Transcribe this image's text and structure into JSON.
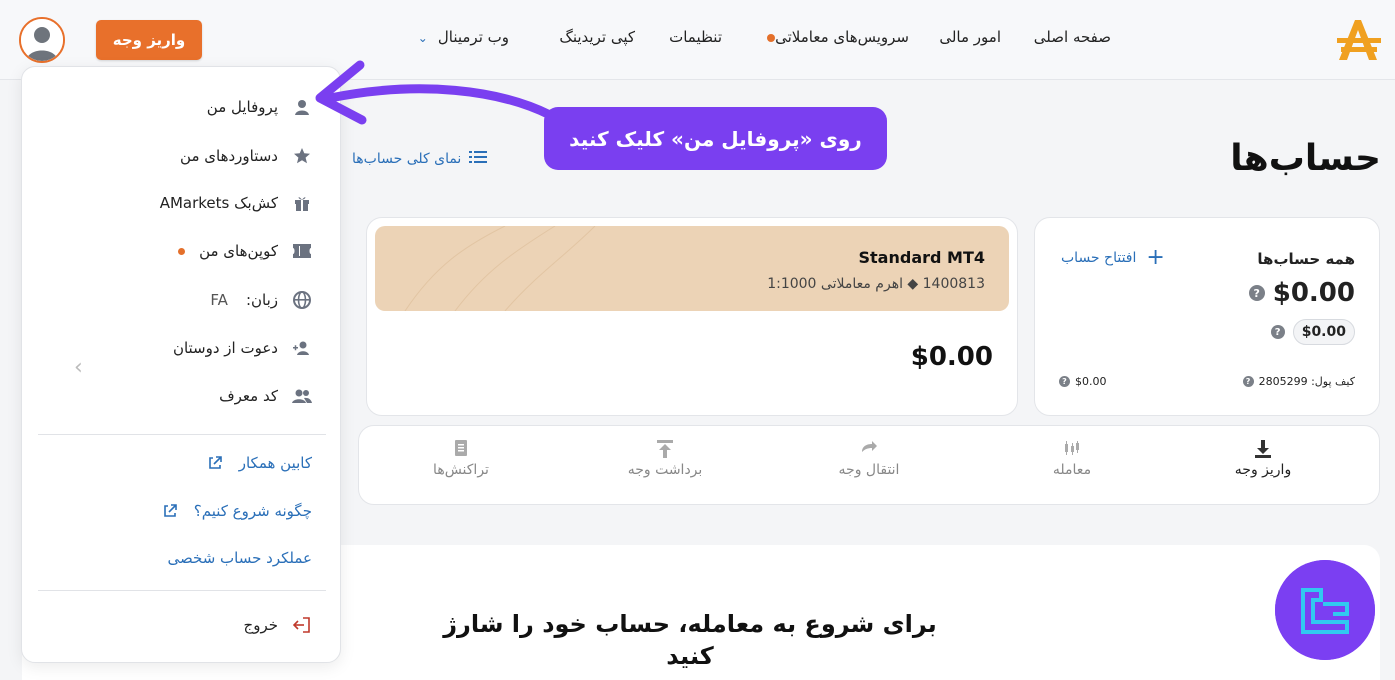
{
  "nav": {
    "home": "صفحه اصلی",
    "finance": "امور مالی",
    "trading_services": "سرویس‌های معاملاتی",
    "settings": "تنظیمات",
    "copy_trading": "کپی تریدینگ",
    "web_terminal": "وب ترمینال",
    "deposit_button": "واریز وجه"
  },
  "page": {
    "title": "حساب‌ها",
    "overview_link": "نمای کلی حساب‌ها"
  },
  "summary": {
    "title": "همه حساب‌ها",
    "open_account": "افتتاح حساب",
    "total": "$0.00",
    "pill": "$0.00",
    "wallet_label": "کیف پول: 2805299",
    "wallet_value": "$0.00"
  },
  "mt4": {
    "name": "Standard MT4",
    "sub": "1400813 ◆ اهرم معاملاتی 1:1000",
    "balance": "$0.00"
  },
  "actions": [
    {
      "label": "واریز وجه",
      "icon": "download-icon"
    },
    {
      "label": "معامله",
      "icon": "candles-icon"
    },
    {
      "label": "انتقال وجه",
      "icon": "transfer-icon"
    },
    {
      "label": "برداشت وجه",
      "icon": "upload-icon"
    },
    {
      "label": "تراکنش‌ها",
      "icon": "receipt-icon"
    }
  ],
  "cta": {
    "line1": "برای شروع به معامله، حساب خود را شارژ",
    "line2": "کنید"
  },
  "dropdown": {
    "profile": "پروفایل من",
    "achievements": "دستاوردهای من",
    "cashback": "کش‌بک AMarkets",
    "coupons": "کوپن‌های من",
    "language_label": "زبان:",
    "language_value": "FA",
    "invite": "دعوت از دوستان",
    "referral": "کد معرف",
    "partner_cabinet": "کابین همکار",
    "how_to_start": "چگونه شروع کنیم؟",
    "personal_performance": "عملکرد حساب شخصی",
    "logout": "خروج"
  },
  "callout": {
    "text": "روی «پروفایل من» کلیک کنید"
  },
  "colors": {
    "accent_orange": "#e8702b",
    "link_blue": "#2a6fb8",
    "callout_purple": "#7a3ff0",
    "card_beige": "#ecd3b6"
  }
}
